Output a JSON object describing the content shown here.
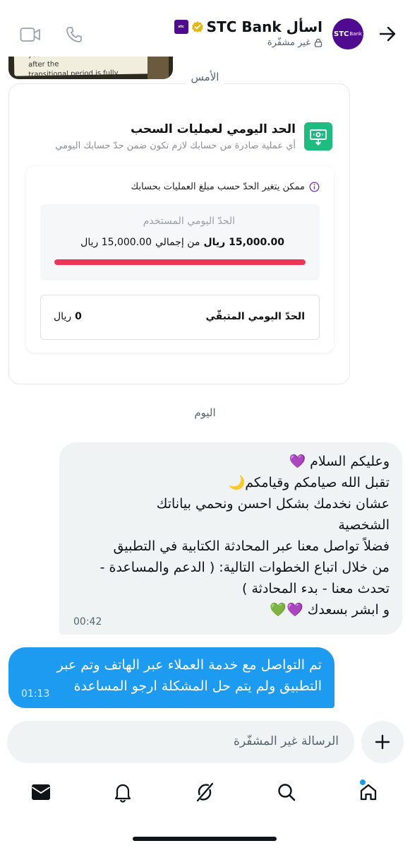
{
  "header": {
    "title": "اسأل STC Bank",
    "subtitle": "غير مشفّرة",
    "avatar_text": "STC",
    "avatar_small": "Bank",
    "brand_badge": "stc"
  },
  "photo": {
    "line1": "your financial transactions after the",
    "line2": "transitional period is fully completed."
  },
  "dates": {
    "yesterday": "الأمس",
    "today": "اليوم"
  },
  "card": {
    "title": "الحد اليومي لعمليات السحب",
    "subtitle": "أي عملية صادرة من حسابك لازم تكون ضمن حدّ حسابك اليومي",
    "info": "ممكن يتغير الحدّ حسب مبلغ العمليات بحسابك",
    "used_label": "الحدّ اليومي المستخدم",
    "used_amount": "15,000.00",
    "used_currency": "ريال",
    "used_of": "من إجمالي",
    "used_total": "15,000.00 ريال",
    "progress_fraction": 1.0,
    "remain_label": "الحدّ اليومي المتبقّي",
    "remain_amount": "0",
    "remain_currency": "ريال"
  },
  "messages": {
    "incoming": {
      "lines": [
        "وعليكم السلام 💜",
        "تقبل الله صيامكم وقيامكم🌙",
        "عشان نخدمك بشكل احسن ونحمي بياناتك",
        "الشخصية",
        "فضلاً تواصل معنا عبر المحادثة الكتابية في التطبيق",
        "من خلال اتباع الخطوات التالية: ( الدعم والمساعدة -",
        "تحدث معنا - بدء المحادثة )",
        "و ابشر بسعدك 💜💚"
      ],
      "time": "00:42"
    },
    "outgoing": {
      "lines": [
        "تم التواصل مع خدمة العملاء عبر الهاتف وتم عبر",
        "التطبيق ولم يتم حل المشكلة ارجو المساعدة"
      ],
      "time": "01:13"
    }
  },
  "composer": {
    "placeholder": "الرسالة غير المشفّرة"
  },
  "colors": {
    "accent": "#1d9bf0",
    "progress": "#ee3558",
    "brand": "#4f0a8f",
    "card_icon": "#1ebc80"
  },
  "icons": {
    "back": "arrow-right-icon",
    "call": "phone-icon",
    "video": "video-camera-icon",
    "verified": "verified-badge-icon",
    "lock": "lock-icon",
    "info": "info-icon",
    "withdraw": "cash-withdraw-icon",
    "plus": "plus-icon",
    "tabs": [
      "home-icon",
      "search-icon",
      "grok-icon",
      "notifications-icon",
      "messages-icon"
    ]
  }
}
